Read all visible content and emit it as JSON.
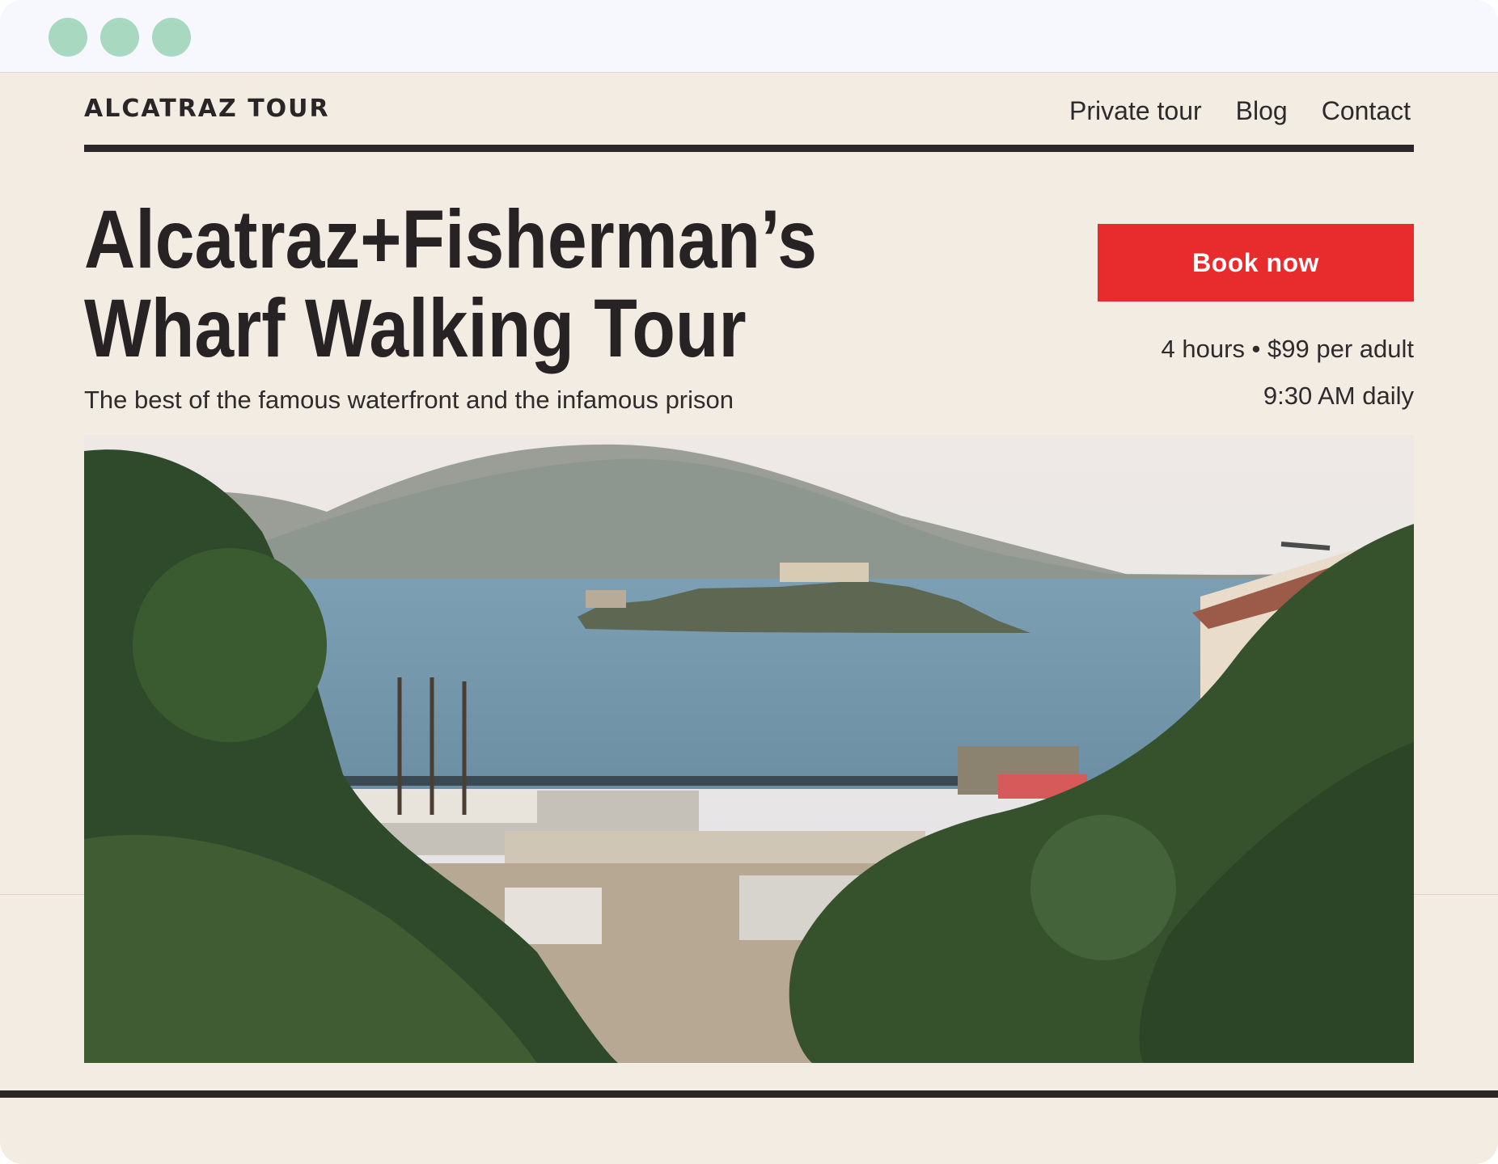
{
  "window": {
    "controls": [
      "window-dot",
      "window-dot",
      "window-dot"
    ],
    "control_color": "#a8d8bf"
  },
  "header": {
    "brand": "ALCATRAZ TOUR",
    "nav": [
      "Private tour",
      "Blog",
      "Contact"
    ]
  },
  "hero": {
    "title_line1": "Alcatraz+Fisherman’s",
    "title_line2": "Wharf Walking Tour",
    "subtitle": "The best of the famous waterfront and the infamous prison",
    "book_label": "Book now",
    "duration_price": "4 hours • $99 per adult",
    "schedule": "9:30 AM daily",
    "image": "photo of Alcatraz island and the bay, seen over trees and a harbor"
  },
  "colors": {
    "background": "#f3ece2",
    "accent": "#e82b2d",
    "text": "#272324"
  }
}
